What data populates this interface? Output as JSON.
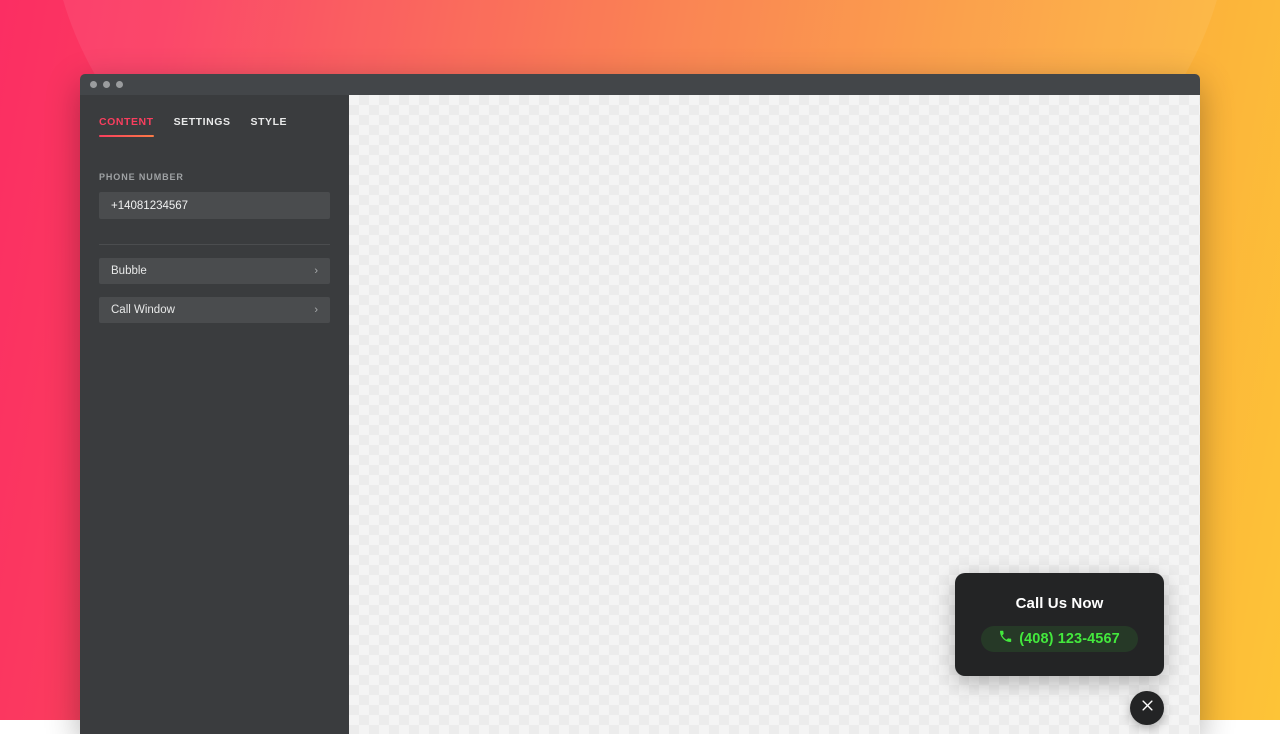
{
  "window": {
    "traffic_lights": [
      "close",
      "minimize",
      "maximize"
    ]
  },
  "sidebar": {
    "tabs": [
      {
        "label": "CONTENT",
        "active": true
      },
      {
        "label": "SETTINGS",
        "active": false
      },
      {
        "label": "STYLE",
        "active": false
      }
    ],
    "phone_field": {
      "label": "PHONE NUMBER",
      "value": "+14081234567",
      "placeholder": "+14081234567"
    },
    "rows": [
      {
        "label": "Bubble",
        "chevron": "chevron-right-icon"
      },
      {
        "label": "Call Window",
        "chevron": "chevron-right-icon"
      }
    ]
  },
  "preview": {
    "widget": {
      "title": "Call Us Now",
      "phone_icon": "phone-handset-icon",
      "phone_display": "(408) 123-4567"
    },
    "close_button": {
      "icon": "close-x-icon",
      "label": "Close"
    }
  },
  "colors": {
    "accent_pink": "#f93e5e",
    "accent_orange": "#fb7b46",
    "call_green": "#43e83d",
    "widget_dark": "#232425",
    "sidebar_bg": "#3a3c3e",
    "titlebar_bg": "#434649"
  }
}
